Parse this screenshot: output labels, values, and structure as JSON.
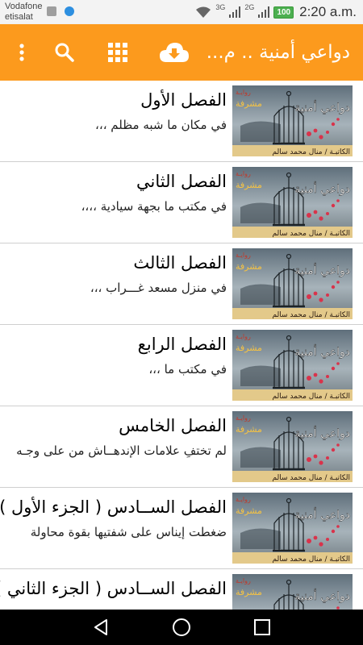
{
  "status_bar": {
    "carrier_line1": "Vodafone",
    "carrier_line2": "etisalat",
    "network1": "3G",
    "network2": "2G",
    "battery": "100",
    "time": "2:20 a.m."
  },
  "app_bar": {
    "title": "دواعي أمنية .. م...",
    "background": "#fc9a1d"
  },
  "chapters": [
    {
      "title": "الفصل الأول",
      "snippet": "في مكان ما شبه مظلم ،،،"
    },
    {
      "title": "الفصل الثاني",
      "snippet": "في مكتب ما بجهة سيادية ،،،،"
    },
    {
      "title": "الفصل الثالث",
      "snippet": "في منزل مسعد غـــراب ،،،"
    },
    {
      "title": "الفصل الرابع",
      "snippet": "في مكتب ما ،،،"
    },
    {
      "title": "الفصل الخامس",
      "snippet": "لم تختفِ علامات الإندهــاش من على وجـه"
    },
    {
      "title": "الفصل الســادس ( الجزء الأول )",
      "snippet": "ضغطت إيناس على شفتيها بقوة محاولة"
    },
    {
      "title": "الفصل الســادس ( الجزء الثاني )",
      "snippet": ""
    }
  ],
  "cover": {
    "label_top": "روايـة",
    "label_brand": "مشرفة",
    "title": "دواعي أمنية",
    "author": "الكاتبـة / منال محمد سالم"
  },
  "icons": {
    "menu": "more-vert-icon",
    "search": "search-icon",
    "grid": "grid-icon",
    "download": "cloud-download-icon",
    "back": "back-icon",
    "home": "home-icon",
    "recents": "recents-icon"
  }
}
